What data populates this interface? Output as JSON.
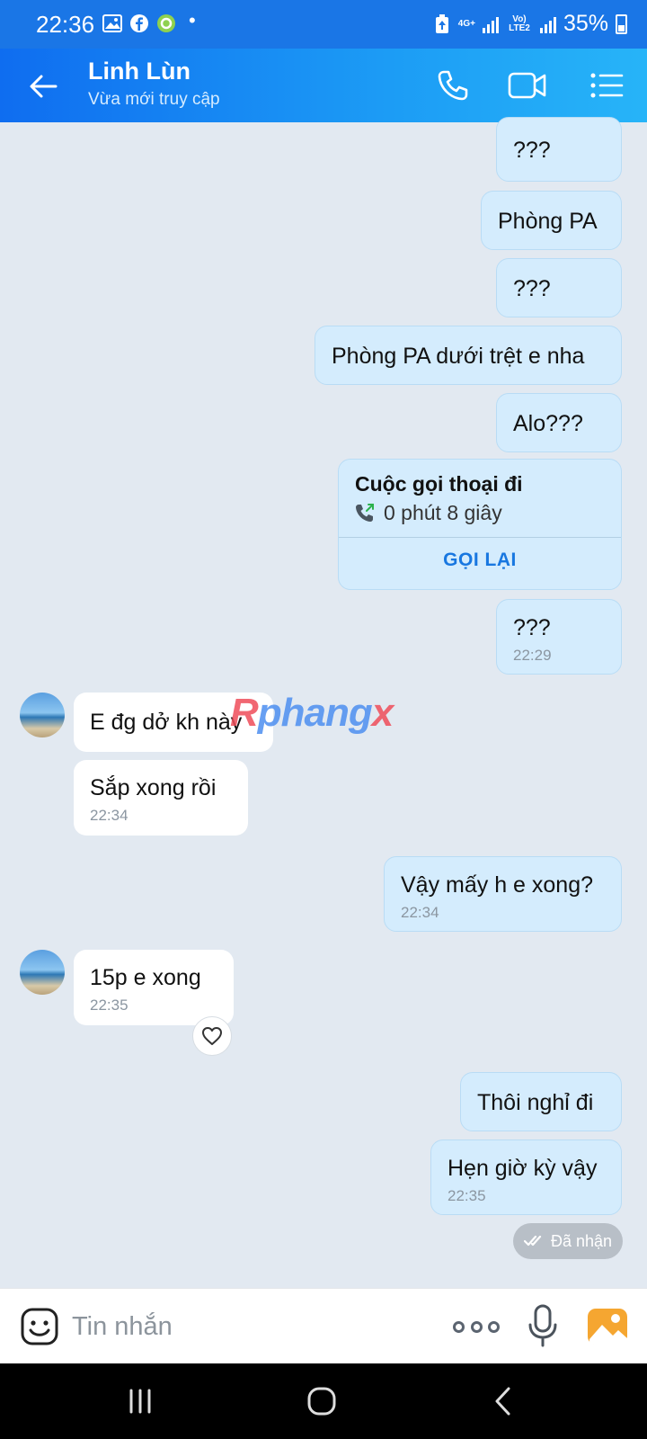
{
  "status_bar": {
    "time": "22:36",
    "net1": "4G+",
    "net2": "Vo) LTE2",
    "battery": "35%"
  },
  "header": {
    "name": "Linh Lùn",
    "status": "Vừa mới truy cập"
  },
  "messages": [
    {
      "text": "???"
    },
    {
      "text": "Phòng PA"
    },
    {
      "text": "???"
    },
    {
      "text": "Phòng PA dưới trệt e nha"
    },
    {
      "text": "Alo???"
    },
    {
      "text": "???",
      "time": "22:29"
    },
    {
      "text": "E đg dở kh này"
    },
    {
      "text": "Sắp xong rồi",
      "time": "22:34"
    },
    {
      "text": "Vậy mấy h e xong?",
      "time": "22:34"
    },
    {
      "text": "15p e xong",
      "time": "22:35"
    },
    {
      "text": "Thôi nghỉ đi"
    },
    {
      "text": "Hẹn giờ kỳ vậy",
      "time": "22:35"
    }
  ],
  "call_card": {
    "title": "Cuộc gọi thoại đi",
    "duration": "0 phút 8 giây",
    "action": "GỌI LẠI"
  },
  "delivery_status": "Đã nhận",
  "watermark": {
    "r": "R",
    "mid": "phang",
    "x": "x"
  },
  "input": {
    "placeholder": "Tin nhắn"
  },
  "colors": {
    "header_start": "#0f6df0",
    "header_end": "#27b4f8",
    "outgoing_bubble": "#d4ecfd",
    "incoming_bubble": "#ffffff",
    "chat_bg": "#e2e9f1",
    "accent": "#1877e0"
  }
}
